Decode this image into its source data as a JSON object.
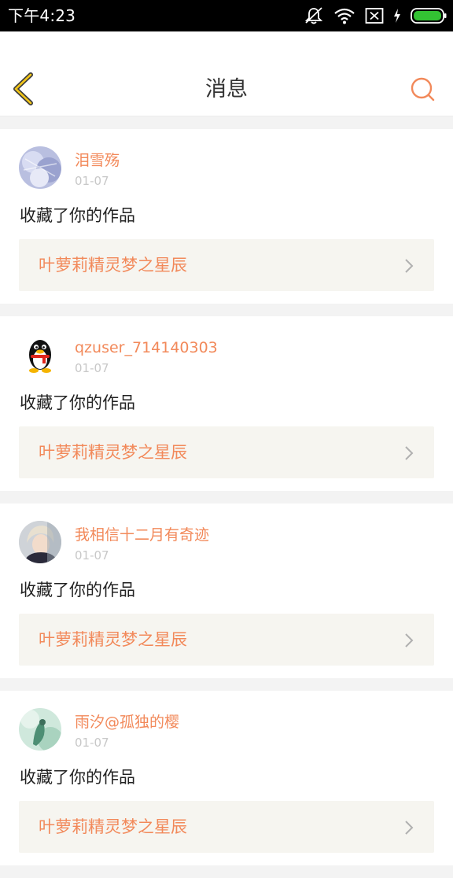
{
  "status_bar": {
    "time": "下午4:23",
    "icons": [
      "mute-icon",
      "wifi-icon",
      "no-sim-icon",
      "charging-icon",
      "battery-icon"
    ],
    "battery_color": "#33c233"
  },
  "header": {
    "title": "消息",
    "back_icon": "back-chevron-icon",
    "search_icon": "search-icon",
    "accent_color": "#f2895a"
  },
  "messages": [
    {
      "username": "泪雪殇",
      "date": "01-07",
      "action": "收藏了你的作品",
      "work_title": "叶萝莉精灵梦之星辰"
    },
    {
      "username": "qzuser_714140303",
      "date": "01-07",
      "action": "收藏了你的作品",
      "work_title": "叶萝莉精灵梦之星辰"
    },
    {
      "username": "我相信十二月有奇迹",
      "date": "01-07",
      "action": "收藏了你的作品",
      "work_title": "叶萝莉精灵梦之星辰"
    },
    {
      "username": "雨汐@孤独的樱",
      "date": "01-07",
      "action": "收藏了你的作品",
      "work_title": "叶萝莉精灵梦之星辰"
    }
  ]
}
